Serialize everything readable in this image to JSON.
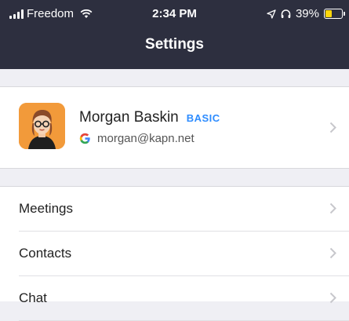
{
  "status_bar": {
    "carrier": "Freedom",
    "time": "2:34 PM",
    "battery": "39%",
    "battery_level": 0.39,
    "battery_color": "#ffd60a"
  },
  "header": {
    "title": "Settings",
    "background": "#2d2f3f"
  },
  "profile": {
    "name": "Morgan Baskin",
    "plan": "BASIC",
    "email": "morgan@kapn.net",
    "account_icon": "google-icon"
  },
  "menu": {
    "items": [
      {
        "label": "Meetings"
      },
      {
        "label": "Contacts"
      },
      {
        "label": "Chat"
      }
    ]
  },
  "colors": {
    "accent": "#2d8cff",
    "background": "#efeff4"
  }
}
